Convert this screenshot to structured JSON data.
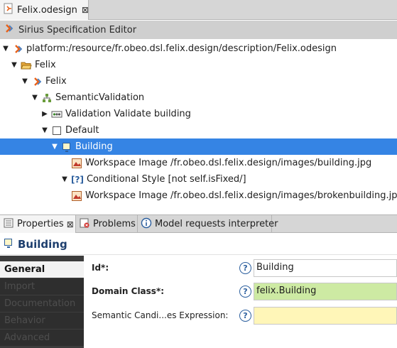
{
  "editor_tab": {
    "label": "Felix.odesign",
    "close": "⊠"
  },
  "editor_title": "Sirius Specification Editor",
  "tree": [
    {
      "label": "platform:/resource/fr.obeo.dsl.felix.design/description/Felix.odesign",
      "twisty": "▼",
      "icon": "resource-icon"
    },
    {
      "label": "Felix",
      "twisty": "▼",
      "icon": "open-folder-icon"
    },
    {
      "label": "Felix",
      "twisty": "▼",
      "icon": "viewpoint-icon"
    },
    {
      "label": "SemanticValidation",
      "twisty": "▼",
      "icon": "validation-tree-icon"
    },
    {
      "label": "Validation Validate building",
      "twisty": "▶",
      "icon": "validation-rule-icon"
    },
    {
      "label": "Default",
      "twisty": "▼",
      "icon": "layer-icon"
    },
    {
      "label": "Building",
      "twisty": "▼",
      "icon": "node-mapping-icon"
    },
    {
      "label": "Workspace Image /fr.obeo.dsl.felix.design/images/building.jpg",
      "twisty": "",
      "icon": "workspace-image-icon"
    },
    {
      "label": "Conditional Style [not self.isFixed/]",
      "twisty": "▼",
      "icon": "conditional-style-icon",
      "prefix": "[?]"
    },
    {
      "label": "Workspace Image /fr.obeo.dsl.felix.design/images/brokenbuilding.jpg",
      "twisty": "",
      "icon": "workspace-image-icon"
    }
  ],
  "views": {
    "properties": "Properties",
    "problems": "Problems",
    "interpreter": "Model requests interpreter",
    "close": "⊠"
  },
  "properties_title": "Building",
  "sections": [
    "General",
    "Import",
    "Documentation",
    "Behavior",
    "Advanced"
  ],
  "form": {
    "id_label": "Id*:",
    "id_value": "Building",
    "domain_label": "Domain Class*:",
    "domain_value": "felix.Building",
    "semantic_label": "Semantic Candi...es Expression:",
    "semantic_value": "",
    "help": "?"
  },
  "colors": {
    "selection": "#3584e4",
    "domain_field": "#cdeaa3",
    "expression_field": "#fff6b8",
    "sirius_orange": "#e8621a"
  }
}
